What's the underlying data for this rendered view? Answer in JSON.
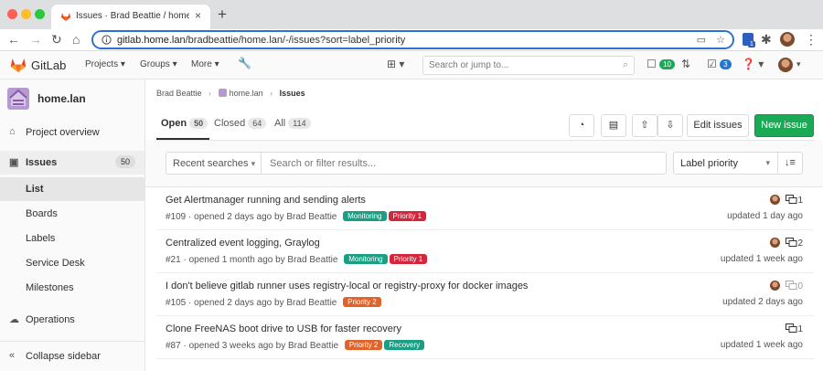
{
  "browser": {
    "tab_title": "Issues · Brad Beattie / home.lan · GitLab",
    "url_host": "gitlab.home.lan",
    "url_path": "/bradbeattie/home.lan/-/issues?sort=label_priority",
    "ext_badge": "1"
  },
  "header": {
    "app_name": "GitLab",
    "menus": [
      "Projects",
      "Groups",
      "More"
    ],
    "search_placeholder": "Search or jump to...",
    "todo_count": "10",
    "issues_count": "3"
  },
  "sidebar": {
    "project_name": "home.lan",
    "items": [
      {
        "label": "Project overview",
        "icon": "home-icon"
      },
      {
        "label": "Issues",
        "icon": "issues-icon",
        "count": "50"
      },
      {
        "label": "List"
      },
      {
        "label": "Boards"
      },
      {
        "label": "Labels"
      },
      {
        "label": "Service Desk"
      },
      {
        "label": "Milestones"
      },
      {
        "label": "Operations",
        "icon": "operations-icon"
      }
    ],
    "collapse_label": "Collapse sidebar"
  },
  "breadcrumb": {
    "owner": "Brad Beattie",
    "project": "home.lan",
    "current": "Issues"
  },
  "tabs": [
    {
      "label": "Open",
      "count": "50"
    },
    {
      "label": "Closed",
      "count": "64"
    },
    {
      "label": "All",
      "count": "114"
    }
  ],
  "actions": {
    "edit_issues": "Edit issues",
    "new_issue": "New issue"
  },
  "filter": {
    "recent_searches": "Recent searches",
    "search_placeholder": "Search or filter results...",
    "sort_value": "Label priority"
  },
  "label_colors": {
    "Monitoring": "#1a9e84",
    "Priority 1": "#d4253b",
    "Priority 2": "#e2632a",
    "Recovery": "#1a9e84"
  },
  "issues": [
    {
      "title": "Get Alertmanager running and sending alerts",
      "meta": "#109 · opened 2 days ago by Brad Beattie",
      "labels": [
        "Monitoring",
        "Priority 1"
      ],
      "comments": "1",
      "updated": "updated 1 day ago"
    },
    {
      "title": "Centralized event logging, Graylog",
      "meta": "#21 · opened 1 month ago by Brad Beattie",
      "labels": [
        "Monitoring",
        "Priority 1"
      ],
      "comments": "2",
      "updated": "updated 1 week ago"
    },
    {
      "title": "I don't believe gitlab runner uses registry-local or registry-proxy for docker images",
      "meta": "#105 · opened 2 days ago by Brad Beattie",
      "labels": [
        "Priority 2"
      ],
      "comments": "0",
      "updated": "updated 2 days ago"
    },
    {
      "title": "Clone FreeNAS boot drive to USB for faster recovery",
      "meta": "#87 · opened 3 weeks ago by Brad Beattie",
      "labels": [
        "Priority 2",
        "Recovery"
      ],
      "comments": "1",
      "updated": "updated 1 week ago"
    }
  ]
}
